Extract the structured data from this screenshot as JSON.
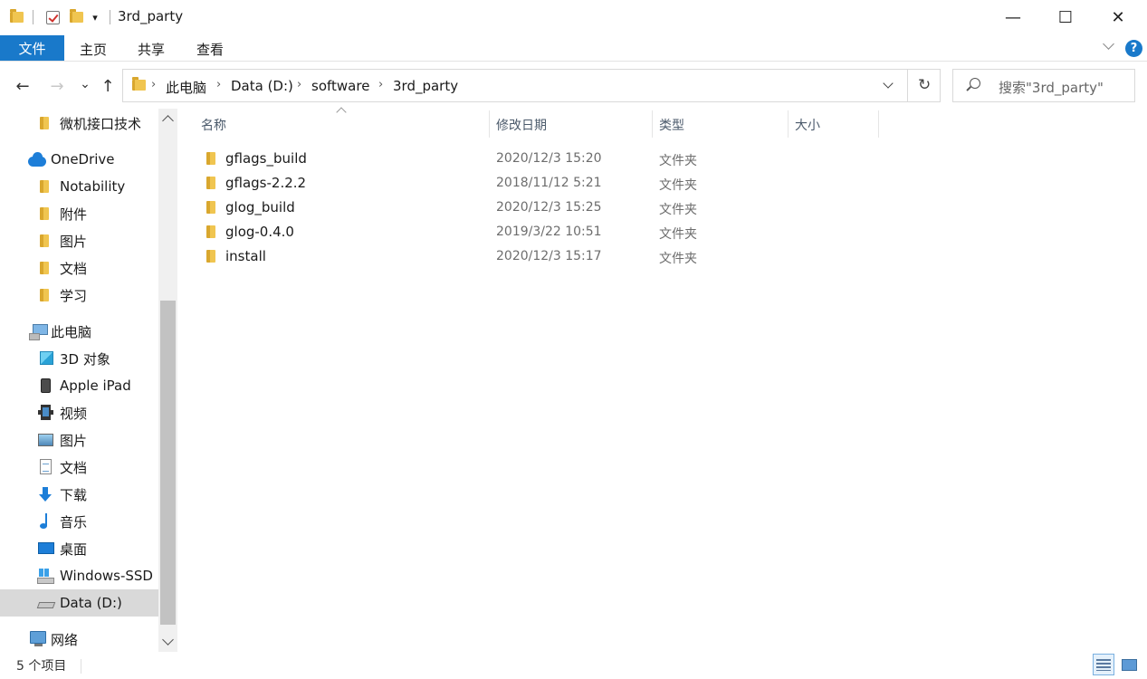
{
  "window": {
    "title": "3rd_party",
    "minimize_glyph": "—",
    "maximize_glyph": "☐",
    "close_glyph": "✕"
  },
  "ribbon": {
    "file_tab": "文件",
    "tabs": [
      "主页",
      "共享",
      "查看"
    ],
    "help_glyph": "?"
  },
  "nav": {
    "back_glyph": "←",
    "forward_glyph": "→",
    "recent_glyph": "⌄",
    "up_glyph": "↑",
    "breadcrumbs": [
      "此电脑",
      "Data (D:)",
      "software",
      "3rd_party"
    ],
    "crumb_separator": "›",
    "refresh_glyph": "↻"
  },
  "search": {
    "placeholder": "搜索\"3rd_party\""
  },
  "sidebar": {
    "items": [
      {
        "label": "微机接口技术",
        "icon": "folder-icon"
      },
      {
        "label": "OneDrive",
        "icon": "onedrive-cloud-icon"
      },
      {
        "label": "Notability",
        "icon": "folder-icon"
      },
      {
        "label": "附件",
        "icon": "folder-icon"
      },
      {
        "label": "图片",
        "icon": "folder-icon"
      },
      {
        "label": "文档",
        "icon": "folder-icon"
      },
      {
        "label": "学习",
        "icon": "folder-icon"
      },
      {
        "label": "此电脑",
        "icon": "this-pc-icon"
      },
      {
        "label": "3D 对象",
        "icon": "3d-objects-icon"
      },
      {
        "label": "Apple iPad",
        "icon": "ipad-icon"
      },
      {
        "label": "视频",
        "icon": "video-icon"
      },
      {
        "label": "图片",
        "icon": "pictures-icon"
      },
      {
        "label": "文档",
        "icon": "documents-icon"
      },
      {
        "label": "下载",
        "icon": "downloads-icon"
      },
      {
        "label": "音乐",
        "icon": "music-icon"
      },
      {
        "label": "桌面",
        "icon": "desktop-icon"
      },
      {
        "label": "Windows-SSD (",
        "icon": "windows-drive-icon"
      },
      {
        "label": "Data (D:)",
        "icon": "drive-icon"
      },
      {
        "label": "网络",
        "icon": "network-icon"
      }
    ]
  },
  "columns": {
    "name": "名称",
    "modified": "修改日期",
    "type": "类型",
    "size": "大小"
  },
  "files": [
    {
      "name": "gflags_build",
      "modified": "2020/12/3 15:20",
      "type": "文件夹"
    },
    {
      "name": "gflags-2.2.2",
      "modified": "2018/11/12 5:21",
      "type": "文件夹"
    },
    {
      "name": "glog_build",
      "modified": "2020/12/3 15:25",
      "type": "文件夹"
    },
    {
      "name": "glog-0.4.0",
      "modified": "2019/3/22 10:51",
      "type": "文件夹"
    },
    {
      "name": "install",
      "modified": "2020/12/3 15:17",
      "type": "文件夹"
    }
  ],
  "status": {
    "item_count": "5 个项目"
  },
  "colors": {
    "accent": "#1979ca",
    "selected_nav": "#d9d9d9",
    "folder": "#f0c550"
  }
}
